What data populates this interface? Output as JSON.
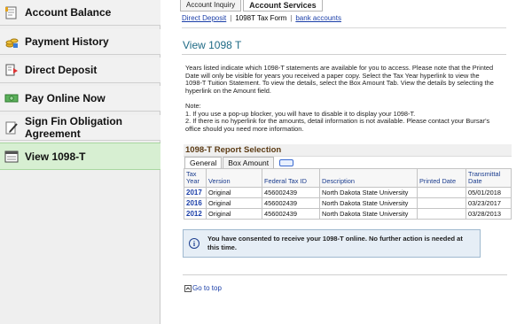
{
  "sidebar": {
    "items": [
      {
        "label": "Account Balance",
        "icon": "document-icon"
      },
      {
        "label": "Payment History",
        "icon": "coins-icon"
      },
      {
        "label": "Direct Deposit",
        "icon": "deposit-icon"
      },
      {
        "label": "Pay Online Now",
        "icon": "money-icon"
      },
      {
        "label": "Sign Fin Obligation Agreement",
        "icon": "pencil-icon"
      },
      {
        "label": "View 1098-T",
        "icon": "form-icon"
      }
    ],
    "active_index": 5
  },
  "tabs": [
    "Account Inquiry",
    "Account Services"
  ],
  "active_tab": "Account Services",
  "subnav": [
    "Direct Deposit",
    "1098T Tax Form",
    "bank accounts"
  ],
  "page_title": "View 1098 T",
  "intro_text": "Years listed indicate which 1098-T statements are available for you to access.  Please note that the Printed Date will only be visible for years you received a paper copy.  Select the Tax Year hyperlink to view the 1098-T Tuition Statement.  To view the details, select the Box Amount Tab.  View the details by selecting the hyperlink on the Amount field.",
  "note": {
    "label": "Note:",
    "items": [
      "1.  If you use a pop-up blocker, you will have to disable it to display your 1098-T.",
      "2.  If there is no hyperlink for the amounts, detail information is not available.  Please contact your Bursar's office should you need more information."
    ]
  },
  "report": {
    "title": "1098-T Report Selection",
    "sub_tabs": [
      "General",
      "Box Amount"
    ],
    "active_sub_tab": "Box Amount",
    "columns": [
      "Tax Year",
      "Version",
      "Federal Tax ID",
      "Description",
      "Printed Date",
      "Transmittal Date"
    ],
    "rows": [
      [
        "2017",
        "Original",
        "456002439",
        "North Dakota State University",
        "",
        "05/01/2018"
      ],
      [
        "2016",
        "Original",
        "456002439",
        "North Dakota State University",
        "",
        "03/23/2017"
      ],
      [
        "2012",
        "Original",
        "456002439",
        "North Dakota State University",
        "",
        "03/28/2013"
      ]
    ]
  },
  "info_message": "You have consented to receive your 1098-T online.  No further action is needed at this time.",
  "goto_top": "Go to top",
  "colors": {
    "active_sidebar": "#d7efd2",
    "title_blue": "#1e6a85",
    "link_blue": "#1a3ea8",
    "section_title_brown": "#5c3b14",
    "info_bg": "#e6eef6"
  }
}
